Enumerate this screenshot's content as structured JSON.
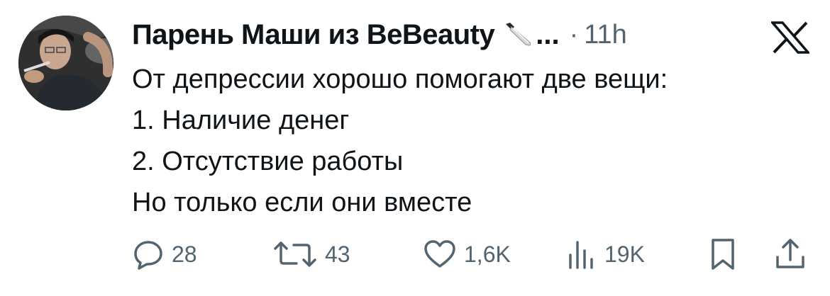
{
  "tweet": {
    "author_name": "Парень Маши из BeBeauty",
    "author_emoji": "knife",
    "ellipsis": "...",
    "separator": "·",
    "time": "11h",
    "text_lines": [
      "От депрессии хорошо помогают две вещи:",
      "1. Наличие денег",
      "2. Отсутствие работы",
      "Но только если они вместе"
    ]
  },
  "actions": {
    "reply": {
      "icon": "reply-icon",
      "count": "28"
    },
    "retweet": {
      "icon": "retweet-icon",
      "count": "43"
    },
    "like": {
      "icon": "heart-icon",
      "count": "1,6K"
    },
    "views": {
      "icon": "views-bar-chart-icon",
      "count": "19K"
    },
    "bookmark": {
      "icon": "bookmark-icon"
    },
    "share": {
      "icon": "share-icon"
    }
  },
  "colors": {
    "text": "#0f1419",
    "secondary": "#536471",
    "background": "#ffffff"
  }
}
